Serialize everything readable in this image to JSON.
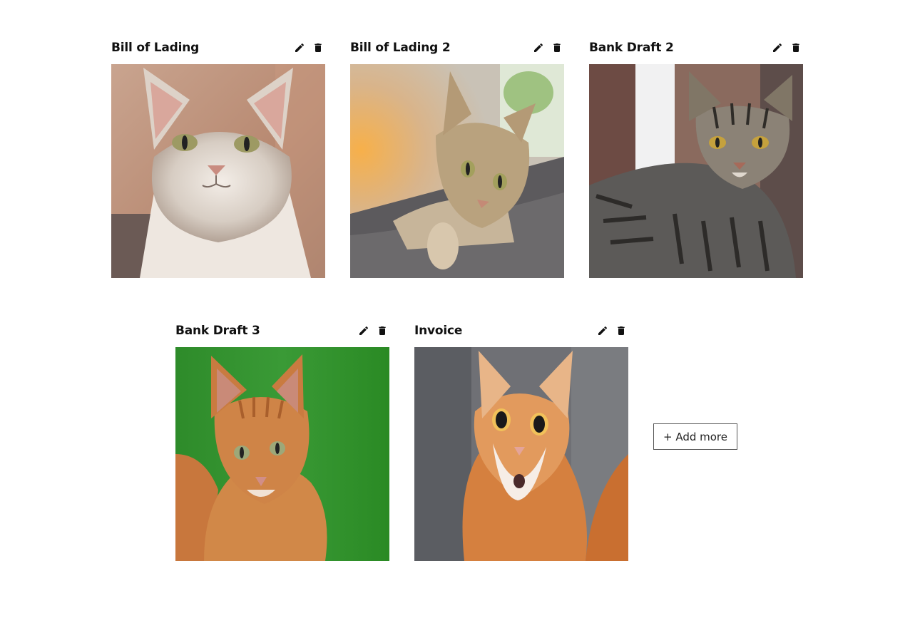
{
  "cards": [
    {
      "title": "Bill of Lading",
      "image": "tabby-white-cat-photo",
      "edit_icon": "pencil-icon",
      "delete_icon": "trash-icon"
    },
    {
      "title": "Bill of Lading 2",
      "image": "tabby-cat-on-blanket-photo",
      "edit_icon": "pencil-icon",
      "delete_icon": "trash-icon"
    },
    {
      "title": "Bank Draft 2",
      "image": "striped-tabby-cat-photo",
      "edit_icon": "pencil-icon",
      "delete_icon": "trash-icon"
    },
    {
      "title": "Bank Draft 3",
      "image": "orange-cat-green-background-photo",
      "edit_icon": "pencil-icon",
      "delete_icon": "trash-icon"
    },
    {
      "title": "Invoice",
      "image": "surprised-orange-cat-photo",
      "edit_icon": "pencil-icon",
      "delete_icon": "trash-icon"
    }
  ],
  "add_more": {
    "label": "+ Add more"
  },
  "colors": {
    "icon": "#111111",
    "button_border": "#555555",
    "background": "#ffffff"
  }
}
